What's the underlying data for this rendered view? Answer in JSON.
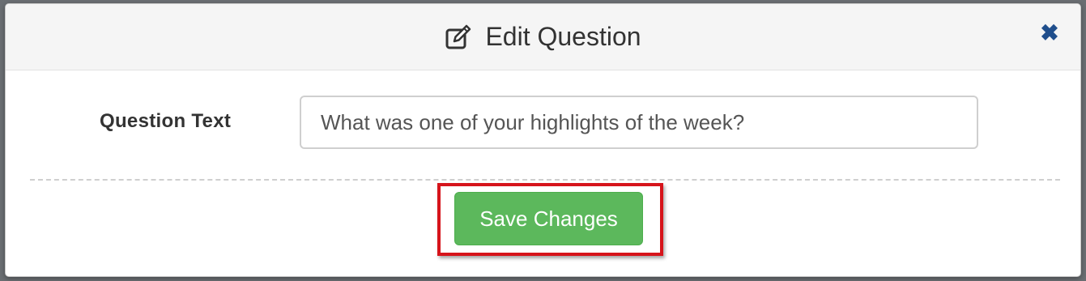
{
  "modal": {
    "title": "Edit Question",
    "title_icon": "edit-icon",
    "close_icon": "close-icon",
    "close_glyph": "✖"
  },
  "form": {
    "question_label": "Question Text",
    "question_value": "What was one of your highlights of the week?"
  },
  "actions": {
    "save_label": "Save Changes"
  },
  "colors": {
    "save_button": "#5cb85c",
    "highlight_border": "#d6141b",
    "close_icon": "#1f4e8c",
    "header_bg": "#f5f5f5"
  }
}
